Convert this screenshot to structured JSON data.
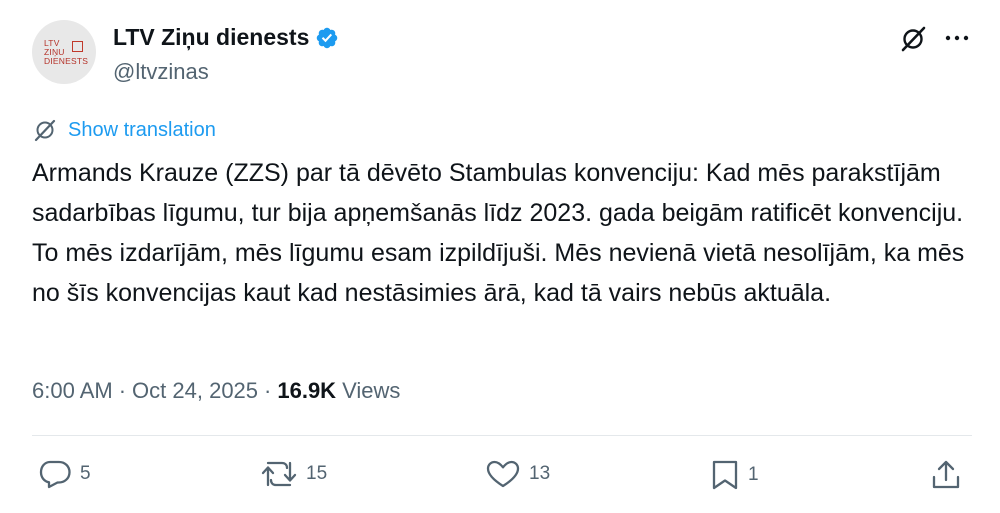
{
  "author": {
    "avatar_text": "LTV\nZIŅU\nDIENESTS",
    "display_name": "LTV Ziņu dienests",
    "handle": "@ltvzinas",
    "verified": true
  },
  "icons": {
    "verified": "verified-badge-icon",
    "grok": "grok-icon",
    "more": "more-icon",
    "translate": "translate-icon",
    "reply": "reply-icon",
    "retweet": "retweet-icon",
    "like": "like-icon",
    "bookmark": "bookmark-icon",
    "share": "share-icon"
  },
  "translate_label": "Show translation",
  "tweet_text": "Armands Krauze (ZZS) par tā dēvēto Stambulas konvenciju: Kad mēs parakstījām sadarbības līgumu, tur bija apņemšanās līdz 2023. gada beigām ratificēt konvenciju. To mēs izdarījām, mēs līgumu esam izpildījuši. Mēs nevienā vietā nesolījām, ka mēs no šīs konvencijas kaut kad nestāsimies ārā, kad tā vairs nebūs aktuāla.",
  "meta": {
    "time": "6:00 AM",
    "separator": "·",
    "date": "Oct 24, 2025",
    "views_count": "16.9K",
    "views_label": "Views"
  },
  "actions": {
    "replies": "5",
    "retweets": "15",
    "likes": "13",
    "bookmarks": "1"
  },
  "colors": {
    "accent": "#1d9bf0",
    "text": "#0f1419",
    "secondary": "#536471",
    "divider": "#e4e8eb"
  }
}
